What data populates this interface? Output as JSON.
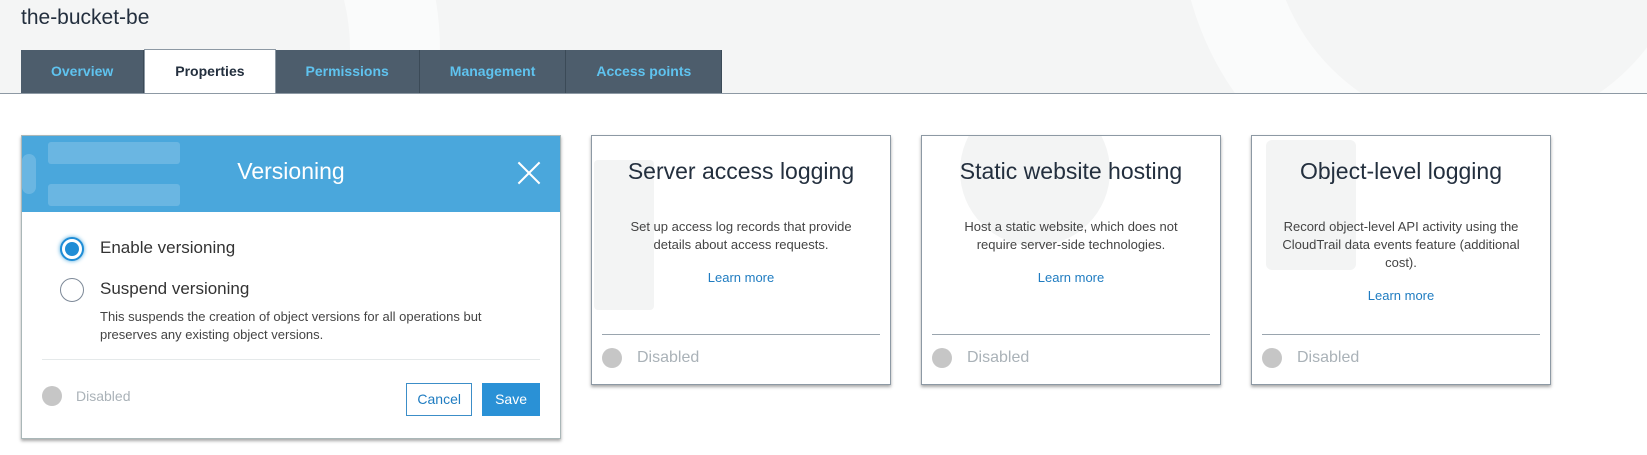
{
  "bucket": {
    "name": "the-bucket-be"
  },
  "tabs": [
    {
      "label": "Overview"
    },
    {
      "label": "Properties"
    },
    {
      "label": "Permissions"
    },
    {
      "label": "Management"
    },
    {
      "label": "Access points"
    }
  ],
  "active_tab": "Properties",
  "versioning": {
    "title": "Versioning",
    "options": [
      {
        "label": "Enable versioning",
        "selected": true
      },
      {
        "label": "Suspend versioning",
        "selected": false,
        "description": "This suspends the creation of object versions for all operations but preserves any existing object versions."
      }
    ],
    "status": "Disabled",
    "cancel_label": "Cancel",
    "save_label": "Save"
  },
  "cards": [
    {
      "title": "Server access logging",
      "description": "Set up access log records that provide details about access requests.",
      "link": "Learn more",
      "status": "Disabled"
    },
    {
      "title": "Static website hosting",
      "description": "Host a static website, which does not require server-side technologies.",
      "link": "Learn more",
      "status": "Disabled"
    },
    {
      "title": "Object-level logging",
      "description": "Record object-level API activity using the CloudTrail data events feature (additional cost).",
      "link": "Learn more",
      "status": "Disabled"
    }
  ],
  "colors": {
    "header_blue": "#4aa7dc",
    "tab_bg": "#4d5d6c",
    "tab_text": "#5fc3ef",
    "link": "#1f7cc1",
    "save_button": "#2a91d6"
  }
}
